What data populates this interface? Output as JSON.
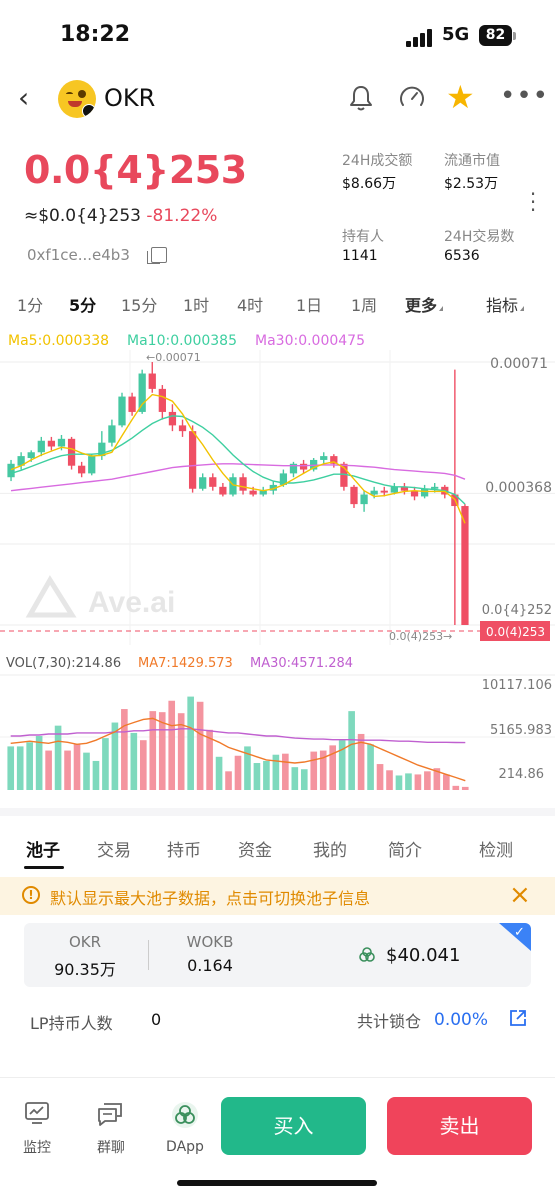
{
  "status": {
    "time": "18:22",
    "network": "5G",
    "battery": "82"
  },
  "header": {
    "title": "OKR"
  },
  "price": {
    "main": "0.0{4}253",
    "usd": "≈$0.0{4}253",
    "change": "-81.22%",
    "address": "0xf1ce...e4b3"
  },
  "stats": [
    {
      "label": "24H成交额",
      "value": "$8.66万"
    },
    {
      "label": "流通市值",
      "value": "$2.53万"
    },
    {
      "label": "持有人",
      "value": "1141"
    },
    {
      "label": "24H交易数",
      "value": "6536"
    }
  ],
  "timeframes": [
    "1分",
    "5分",
    "15分",
    "1时",
    "4时",
    "1日",
    "1周",
    "更多",
    "指标"
  ],
  "active_timeframe": "5分",
  "ma_legend": {
    "ma5": "Ma5:0.000338",
    "ma10": "Ma10:0.000385",
    "ma30": "Ma30:0.000475"
  },
  "colors": {
    "up": "#46c8a2",
    "down": "#ef4f64",
    "ma5": "#f2c200",
    "ma10": "#3ecfa0",
    "ma30": "#d86be0",
    "vol_ma7": "#f07a2a",
    "vol_ma30": "#c060d0",
    "accent_blue": "#2a6ff0",
    "warn": "#e08a00"
  },
  "chart_data": {
    "type": "candlestick",
    "y_ticks": [
      "0.00071",
      "0.000368",
      "0.0{4}252"
    ],
    "current_price_tag": "0.0(4)253",
    "max_annotation": "←0.00071",
    "min_annotation": "0.0(4)253→",
    "watermark": "Ave.ai",
    "candles": [
      {
        "o": 0.00041,
        "c": 0.000445,
        "h": 0.000455,
        "l": 0.0004
      },
      {
        "o": 0.00044,
        "c": 0.000465,
        "h": 0.000475,
        "l": 0.00043
      },
      {
        "o": 0.00046,
        "c": 0.000475,
        "h": 0.00048,
        "l": 0.00045
      },
      {
        "o": 0.000475,
        "c": 0.000505,
        "h": 0.000515,
        "l": 0.000465
      },
      {
        "o": 0.000505,
        "c": 0.00049,
        "h": 0.000515,
        "l": 0.00048
      },
      {
        "o": 0.00049,
        "c": 0.00051,
        "h": 0.00052,
        "l": 0.00048
      },
      {
        "o": 0.00051,
        "c": 0.00044,
        "h": 0.000515,
        "l": 0.00043
      },
      {
        "o": 0.00044,
        "c": 0.00042,
        "h": 0.00045,
        "l": 0.00041
      },
      {
        "o": 0.00042,
        "c": 0.000465,
        "h": 0.00047,
        "l": 0.000415
      },
      {
        "o": 0.000465,
        "c": 0.0005,
        "h": 0.00053,
        "l": 0.000455
      },
      {
        "o": 0.0005,
        "c": 0.000545,
        "h": 0.00056,
        "l": 0.00049
      },
      {
        "o": 0.000545,
        "c": 0.00062,
        "h": 0.00063,
        "l": 0.00054
      },
      {
        "o": 0.00062,
        "c": 0.00058,
        "h": 0.00063,
        "l": 0.00057
      },
      {
        "o": 0.00058,
        "c": 0.00068,
        "h": 0.00069,
        "l": 0.000575
      },
      {
        "o": 0.00068,
        "c": 0.00064,
        "h": 0.00071,
        "l": 0.00063
      },
      {
        "o": 0.00064,
        "c": 0.00058,
        "h": 0.00065,
        "l": 0.00056
      },
      {
        "o": 0.00058,
        "c": 0.000545,
        "h": 0.0006,
        "l": 0.00053
      },
      {
        "o": 0.000545,
        "c": 0.00053,
        "h": 0.00056,
        "l": 0.000515
      },
      {
        "o": 0.00053,
        "c": 0.00038,
        "h": 0.000545,
        "l": 0.00037
      },
      {
        "o": 0.00038,
        "c": 0.00041,
        "h": 0.00042,
        "l": 0.000375
      },
      {
        "o": 0.00041,
        "c": 0.000385,
        "h": 0.00042,
        "l": 0.000375
      },
      {
        "o": 0.000385,
        "c": 0.000365,
        "h": 0.000395,
        "l": 0.00036
      },
      {
        "o": 0.000365,
        "c": 0.00041,
        "h": 0.00042,
        "l": 0.00036
      },
      {
        "o": 0.00041,
        "c": 0.000375,
        "h": 0.00042,
        "l": 0.000365
      },
      {
        "o": 0.000375,
        "c": 0.000365,
        "h": 0.000385,
        "l": 0.00036
      },
      {
        "o": 0.000365,
        "c": 0.000375,
        "h": 0.000385,
        "l": 0.00036
      },
      {
        "o": 0.000375,
        "c": 0.00039,
        "h": 0.0004,
        "l": 0.000365
      },
      {
        "o": 0.00039,
        "c": 0.00042,
        "h": 0.00043,
        "l": 0.000385
      },
      {
        "o": 0.00042,
        "c": 0.000445,
        "h": 0.00045,
        "l": 0.00041
      },
      {
        "o": 0.000445,
        "c": 0.00043,
        "h": 0.000455,
        "l": 0.00042
      },
      {
        "o": 0.00043,
        "c": 0.000455,
        "h": 0.00046,
        "l": 0.000425
      },
      {
        "o": 0.000455,
        "c": 0.000465,
        "h": 0.000475,
        "l": 0.000445
      },
      {
        "o": 0.000465,
        "c": 0.000445,
        "h": 0.00047,
        "l": 0.000435
      },
      {
        "o": 0.000445,
        "c": 0.000385,
        "h": 0.00045,
        "l": 0.000375
      },
      {
        "o": 0.000385,
        "c": 0.00034,
        "h": 0.00039,
        "l": 0.00033
      },
      {
        "o": 0.00034,
        "c": 0.000365,
        "h": 0.000375,
        "l": 0.00032
      },
      {
        "o": 0.000365,
        "c": 0.000375,
        "h": 0.000385,
        "l": 0.000355
      },
      {
        "o": 0.000375,
        "c": 0.00037,
        "h": 0.000385,
        "l": 0.00036
      },
      {
        "o": 0.00037,
        "c": 0.000385,
        "h": 0.000395,
        "l": 0.000365
      },
      {
        "o": 0.000385,
        "c": 0.000375,
        "h": 0.000395,
        "l": 0.000365
      },
      {
        "o": 0.000375,
        "c": 0.00036,
        "h": 0.000385,
        "l": 0.00035
      },
      {
        "o": 0.00036,
        "c": 0.00038,
        "h": 0.00039,
        "l": 0.000355
      },
      {
        "o": 0.00038,
        "c": 0.000385,
        "h": 0.000395,
        "l": 0.00037
      },
      {
        "o": 0.000385,
        "c": 0.000365,
        "h": 0.00039,
        "l": 0.000355
      },
      {
        "o": 0.000365,
        "c": 0.000335,
        "h": 0.00069,
        "l": 2.53e-05
      },
      {
        "o": 0.000335,
        "c": 2.53e-05,
        "h": 0.00034,
        "l": 2.53e-05
      }
    ],
    "ma5": [
      0.00043,
      0.00044,
      0.000455,
      0.000468,
      0.000478,
      0.000488,
      0.000484,
      0.000473,
      0.000465,
      0.000467,
      0.000475,
      0.000518,
      0.00056,
      0.0006,
      0.000625,
      0.00062,
      0.000608,
      0.000575,
      0.00053,
      0.000495,
      0.000455,
      0.00042,
      0.00039,
      0.000385,
      0.00038,
      0.000375,
      0.00038,
      0.00039,
      0.000405,
      0.00042,
      0.000435,
      0.000445,
      0.00045,
      0.000435,
      0.000405,
      0.000375,
      0.00036,
      0.000362,
      0.000368,
      0.000373,
      0.000375,
      0.000373,
      0.000373,
      0.000373,
      0.000352,
      0.00029
    ],
    "ma10": [
      0.00042,
      0.000428,
      0.000438,
      0.000448,
      0.000458,
      0.000466,
      0.00047,
      0.00047,
      0.00047,
      0.000472,
      0.00048,
      0.000495,
      0.000512,
      0.000532,
      0.00055,
      0.000562,
      0.00057,
      0.000568,
      0.000555,
      0.00054,
      0.00052,
      0.000495,
      0.000468,
      0.000445,
      0.000425,
      0.00041,
      0.0004,
      0.000395,
      0.000395,
      0.000398,
      0.000403,
      0.00041,
      0.000418,
      0.000418,
      0.000413,
      0.000405,
      0.000397,
      0.00039,
      0.000385,
      0.000385,
      0.000383,
      0.00038,
      0.000378,
      0.000375,
      0.000365,
      0.00034
    ],
    "ma30": [
      0.000375,
      0.000378,
      0.000381,
      0.000384,
      0.000387,
      0.00039,
      0.000393,
      0.000396,
      0.000399,
      0.000402,
      0.000405,
      0.00041,
      0.000415,
      0.00042,
      0.000425,
      0.00043,
      0.000435,
      0.000438,
      0.00044,
      0.000442,
      0.000444,
      0.000445,
      0.000445,
      0.000444,
      0.000443,
      0.000442,
      0.000441,
      0.00044,
      0.00044,
      0.00044,
      0.000441,
      0.000442,
      0.000442,
      0.000441,
      0.00044,
      0.000438,
      0.000436,
      0.000433,
      0.00043,
      0.000428,
      0.000426,
      0.000424,
      0.000422,
      0.00042,
      0.000415,
      0.000405
    ],
    "volume": {
      "legend": {
        "vol": "VOL(7,30):214.86",
        "ma7": "MA7:1429.573",
        "ma30": "MA30:4571.284"
      },
      "y_ticks": [
        "10117.106",
        "5165.983",
        "214.86"
      ],
      "bars": [
        4200,
        4200,
        4600,
        5200,
        3800,
        6200,
        3800,
        4400,
        3600,
        2800,
        5000,
        6500,
        7800,
        5500,
        4800,
        7600,
        7500,
        8600,
        7400,
        9000,
        8500,
        5800,
        3200,
        1800,
        3300,
        4200,
        2600,
        2800,
        3400,
        3500,
        2200,
        2000,
        3700,
        3800,
        4300,
        4800,
        7600,
        5400,
        4400,
        2500,
        1900,
        1400,
        1600,
        1500,
        1800,
        2100,
        1500,
        400,
        300
      ],
      "ma7": [
        4500,
        4600,
        4700,
        4600,
        4500,
        4700,
        4600,
        4400,
        4500,
        4800,
        5200,
        5600,
        6200,
        6500,
        6800,
        6900,
        6500,
        6200,
        6300,
        6000,
        5400,
        5000,
        4600,
        4100,
        3800,
        3500,
        3200,
        2900,
        2800,
        2700,
        2600,
        2700,
        2900,
        3100,
        3500,
        3900,
        4400,
        4600,
        4400,
        4000,
        3600,
        3200,
        2800,
        2400,
        2100,
        1800,
        1500,
        1200,
        900
      ],
      "ma30": [
        5200,
        5200,
        5300,
        5300,
        5400,
        5400,
        5400,
        5500,
        5500,
        5500,
        5500,
        5600,
        5600,
        5700,
        5700,
        5800,
        5800,
        5800,
        5900,
        5900,
        5800,
        5700,
        5600,
        5500,
        5500,
        5400,
        5300,
        5200,
        5200,
        5100,
        5000,
        4950,
        4900,
        4900,
        4850,
        4850,
        4850,
        4800,
        4800,
        4800,
        4750,
        4700,
        4700,
        4650,
        4600,
        4600,
        4600,
        4580,
        4570
      ]
    }
  },
  "pool_tabs": [
    "池子",
    "交易",
    "持币",
    "资金",
    "我的",
    "简介",
    "检测"
  ],
  "notice": {
    "text": "默认显示最大池子数据，点击可切换池子信息"
  },
  "pool": {
    "token_a": {
      "symbol": "OKR",
      "amount": "90.35万"
    },
    "token_b": {
      "symbol": "WOKB",
      "amount": "0.164"
    },
    "tvl": "$40.041"
  },
  "lp": {
    "holders_label": "LP持币人数",
    "holders_value": "0",
    "locked_label": "共计锁仓",
    "locked_value": "0.00%"
  },
  "bottom_nav": [
    {
      "label": "监控",
      "icon": "monitor-icon"
    },
    {
      "label": "群聊",
      "icon": "chat-icon"
    },
    {
      "label": "DApp",
      "icon": "dapp-icon"
    }
  ],
  "actions": {
    "buy": "买入",
    "sell": "卖出"
  }
}
